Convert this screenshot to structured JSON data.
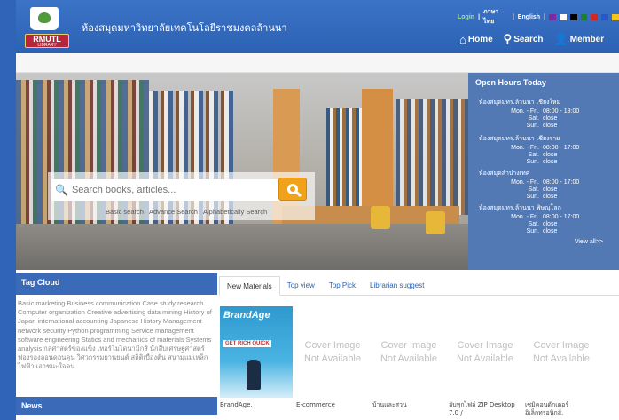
{
  "header": {
    "site_title": "ห้องสมุดมหาวิทยาลัยเทคโนโลยีราชมงคลล้านนา",
    "logo_text": "RMUTL",
    "logo_subtext": "LIBRARY",
    "top_links": {
      "login": "Login",
      "thai": "ภาษาไทย",
      "english": "English",
      "sep": "|"
    },
    "theme_colors": [
      "#7b2ca0",
      "#ffffff",
      "#000000",
      "#1e7d2e",
      "#d42626",
      "#2759c4",
      "#f4c41a"
    ],
    "nav": [
      {
        "label": "Home",
        "icon": "home-icon"
      },
      {
        "label": "Search",
        "icon": "search-icon"
      },
      {
        "label": "Member",
        "icon": "member-icon"
      }
    ]
  },
  "search": {
    "placeholder": "Search books, articles...",
    "links": [
      "Basic search",
      "Advance Search",
      "Alphabetically Search"
    ]
  },
  "open_hours": {
    "title": "Open Hours Today",
    "branches": [
      {
        "name": "ห้องสมุดมทร.ล้านนา เชียงใหม่",
        "rows": [
          [
            "Mon. - Fri.",
            "08:00 - 19:00"
          ],
          [
            "Sat.",
            "close"
          ],
          [
            "Sun.",
            "close"
          ]
        ]
      },
      {
        "name": "ห้องสมุดมทร.ล้านนา เชียงราย",
        "rows": [
          [
            "Mon. - Fri.",
            "08:00 - 17:00"
          ],
          [
            "Sat.",
            "close"
          ],
          [
            "Sun.",
            "close"
          ]
        ]
      },
      {
        "name": "ห้องสมุดลำปางเทค",
        "rows": [
          [
            "Mon. - Fri.",
            "08:00 - 17:00"
          ],
          [
            "Sat.",
            "close"
          ],
          [
            "Sun.",
            "close"
          ]
        ]
      },
      {
        "name": "ห้องสมุดมทร.ล้านนา พิษณุโลก",
        "rows": [
          [
            "Mon. - Fri.",
            "08:00 - 17:00"
          ],
          [
            "Sat.",
            "close"
          ],
          [
            "Sun.",
            "close"
          ]
        ]
      }
    ],
    "view_all": "View all>>"
  },
  "tag_cloud": {
    "title": "Tag Cloud",
    "text": "Basic marketing Business communication Case study research Computer organization Creative advertising data mining History of Japan international accounting Japanese History Management network security Python programming Service management software engineering Statics and mechanics of materials Systems analysis กลศาสตร์ของแข็ง เทอร์โมไดนามิกส์ นักสืบเศรษฐศาสตร์ ฟองรองลอนดอนคุน วิศวกรรมยานยนต์ สถิติเบื้องต้น สนามแม่เหล็กไฟฟ้า เอาชนะใจคน"
  },
  "news": {
    "title": "News"
  },
  "tabs": [
    "New Materials",
    "Top view",
    "Top Pick",
    "Librarian suggest"
  ],
  "books": [
    {
      "title": "BrandAge.",
      "cover_title": "BrandAge",
      "cover_sub": "GET RICH QUICK"
    },
    {
      "title": "E-commerce",
      "cover_line1": "Cover Image",
      "cover_line2": "Not Available"
    },
    {
      "title": "บ้านและสวน",
      "cover_line1": "Cover Image",
      "cover_line2": "Not Available"
    },
    {
      "title": "ลับทุกไฟล์ ZIP Desktop 7.0 /",
      "cover_line1": "Cover Image",
      "cover_line2": "Not Available"
    },
    {
      "title": "เซมิคอนดักเตอร์อิเล็กทรอนิกส์.",
      "cover_line1": "Cover Image",
      "cover_line2": "Not Available"
    }
  ]
}
